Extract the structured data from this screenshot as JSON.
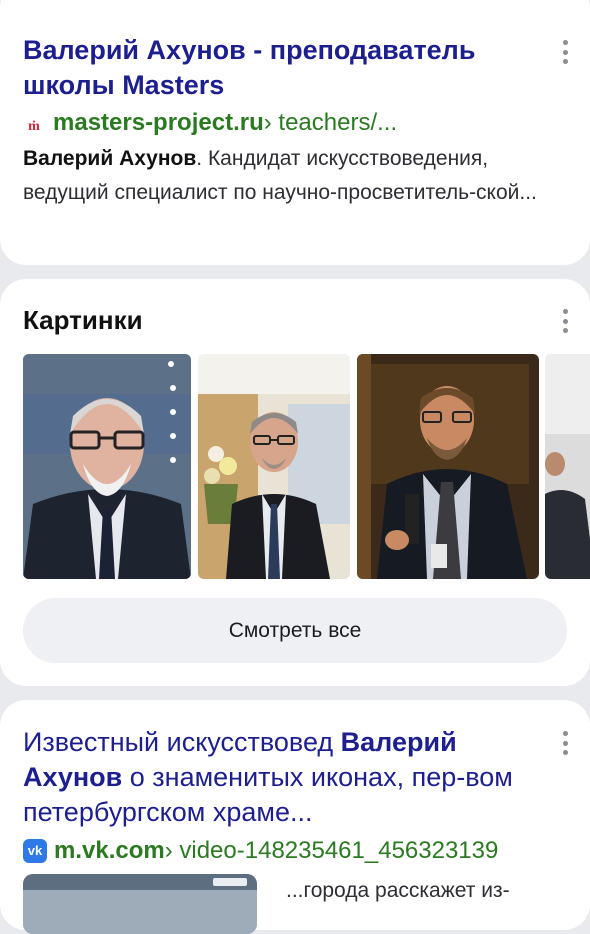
{
  "results": [
    {
      "title": "Валерий Ахунов - преподаватель школы Masters",
      "domain": "masters-project.ru",
      "path": " › teachers/...",
      "snippet_bold": "Валерий Ахунов",
      "snippet_rest": ". Кандидат искусствоведения, ведущий специалист по научно-просветитель-ской...",
      "favicon": "ṁ"
    },
    {
      "title_parts": [
        "Известный искусствовед ",
        "Валерий Ахунов",
        " о знаменитых иконах, пер-вом петербургском храме..."
      ],
      "domain": "m.vk.com",
      "path": " › video-148235461_456323139",
      "snippet_rest": "...города расскажет из-",
      "favicon": "vk"
    }
  ],
  "images_block": {
    "title": "Картинки",
    "button_label": "Смотреть все"
  }
}
